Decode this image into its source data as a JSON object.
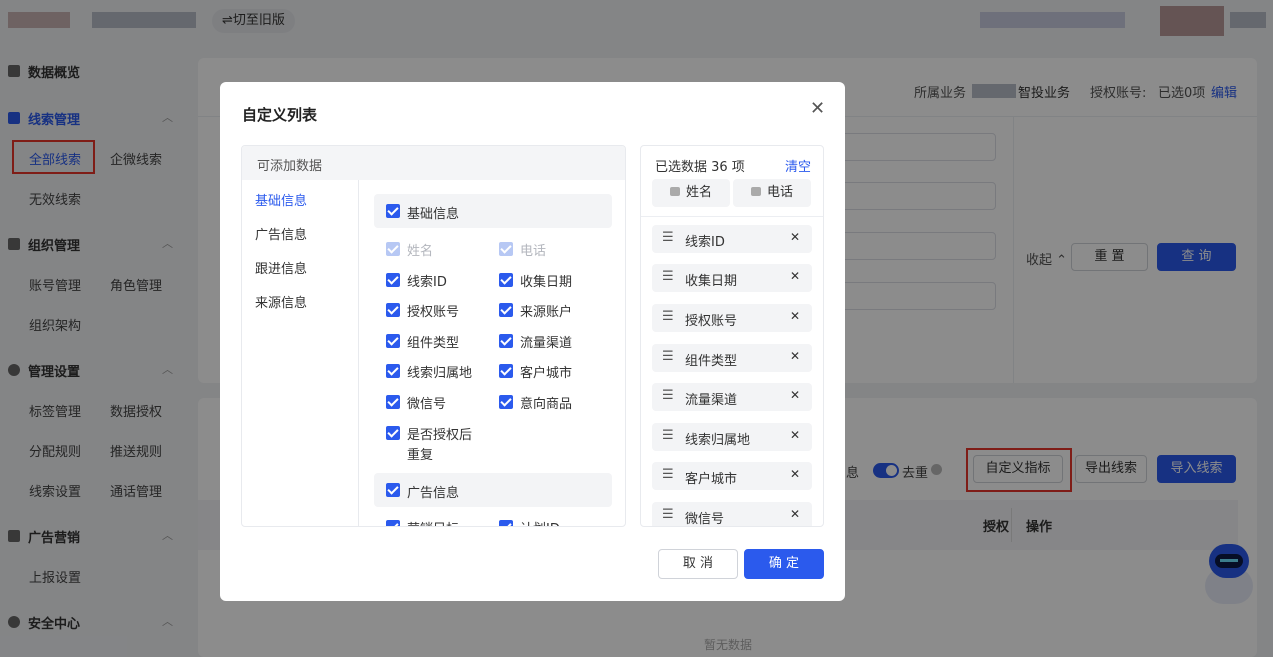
{
  "topbar": {
    "switch_label": "⇌切至旧版"
  },
  "sidebar": {
    "sections": [
      {
        "label": "数据概览"
      },
      {
        "label": "线索管理"
      },
      {
        "label": "组织管理"
      },
      {
        "label": "管理设置"
      },
      {
        "label": "广告营销"
      },
      {
        "label": "安全中心"
      }
    ],
    "clue": {
      "all": "全部线索",
      "wechat": "企微线索",
      "invalid": "无效线索"
    },
    "org": {
      "account": "账号管理",
      "role": "角色管理",
      "structure": "组织架构"
    },
    "settings": {
      "tag": "标签管理",
      "data_auth": "数据授权",
      "assign": "分配规则",
      "push": "推送规则",
      "clue_setting": "线索设置",
      "call": "通话管理"
    },
    "ad": {
      "report": "上报设置"
    }
  },
  "header": {
    "business_label": "所属业务",
    "business_value": "智投业务",
    "auth_label": "授权账号:",
    "auth_value": "已选0项",
    "edit": "编辑"
  },
  "filter": {
    "collapse": "收起",
    "reset": "重 置",
    "query": "查 询"
  },
  "toolbar": {
    "info_fragment": "息",
    "dedupe": "去重",
    "custom_metric": "自定义指标",
    "export": "导出线索",
    "import": "导入线索"
  },
  "table": {
    "col_auth": "授权",
    "col_op": "操作",
    "empty": "暂无数据"
  },
  "modal": {
    "title": "自定义列表",
    "left_header": "可添加数据",
    "categories": [
      "基础信息",
      "广告信息",
      "跟进信息",
      "来源信息"
    ],
    "group_basic": "基础信息",
    "group_ad": "广告信息",
    "fields": {
      "name": "姓名",
      "phone": "电话",
      "clue_id": "线索ID",
      "collect_date": "收集日期",
      "auth_account": "授权账号",
      "source_account": "来源账户",
      "component_type": "组件类型",
      "traffic_channel": "流量渠道",
      "clue_location": "线索归属地",
      "customer_city": "客户城市",
      "wechat": "微信号",
      "intent_product": "意向商品",
      "is_auth_line1": "是否授权后",
      "is_auth_line2": "重复",
      "marketing_goal": "营销目标",
      "plan_id": "计划ID"
    },
    "selected_header": "已选数据 36 项",
    "clear": "清空",
    "locked": [
      "姓名",
      "电话"
    ],
    "selected": [
      "线索ID",
      "收集日期",
      "授权账号",
      "组件类型",
      "流量渠道",
      "线索归属地",
      "客户城市",
      "微信号"
    ],
    "cancel": "取 消",
    "confirm": "确 定"
  }
}
